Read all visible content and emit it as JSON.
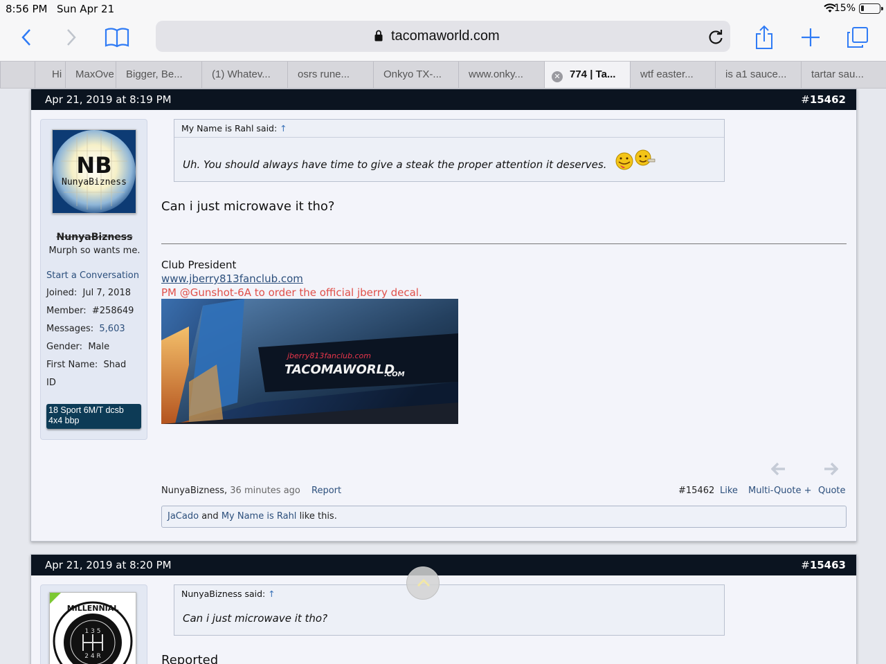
{
  "status_bar": {
    "time": "8:56 PM",
    "date": "Sun Apr 21",
    "battery": "15%"
  },
  "browser": {
    "url": "tacomaworld.com",
    "tabs": [
      {
        "label": "Hi"
      },
      {
        "label": "MaxOve"
      },
      {
        "label": "Bigger, Be..."
      },
      {
        "label": "(1) Whatev..."
      },
      {
        "label": "osrs rune..."
      },
      {
        "label": "Onkyo TX-..."
      },
      {
        "label": "www.onky..."
      },
      {
        "label": "774 | Ta...",
        "active": true
      },
      {
        "label": "wtf easter..."
      },
      {
        "label": "is a1 sauce..."
      },
      {
        "label": "tartar sau..."
      }
    ]
  },
  "post1": {
    "date": "Apr 21, 2019 at 8:19 PM",
    "number_prefix": "#",
    "number": "15462",
    "user": {
      "avatar_text_big": "NB",
      "avatar_text_small": "NunyaBizness",
      "name": "NunyaBizness",
      "title": "Murph so wants me.",
      "start_conversation": "Start a Conversation",
      "stats": [
        {
          "label": "Joined:",
          "value": "Jul 7, 2018"
        },
        {
          "label": "Member:",
          "value": "#258649"
        },
        {
          "label": "Messages:",
          "value": "5,603"
        },
        {
          "label": "Gender:",
          "value": "Male"
        },
        {
          "label": "First Name:",
          "value": "Shad"
        },
        {
          "label": "ID",
          "value": ""
        }
      ],
      "badge": "18 Sport 6M/T dcsb 4x4 bbp"
    },
    "quote": {
      "author": "My Name is Rahl said:",
      "arrow": "↑",
      "text": "Uh. You should always have time to give a steak the proper attention it deserves."
    },
    "message": "Can i just microwave it tho?",
    "signature": {
      "line1": "Club President",
      "link": "www.jberry813fanclub.com",
      "line3": "PM @Gunshot-6A to order the official jberry decal.",
      "decal_small": "jberry813fanclub.com",
      "decal_big": "TACOMAWORLD",
      "decal_com": ".COM"
    },
    "footer": {
      "author": "NunyaBizness,",
      "time": "36 minutes ago",
      "report": "Report",
      "num": "#15462",
      "like": "Like",
      "multiquote": "Multi-Quote +",
      "quote": "Quote"
    },
    "likes": {
      "user1": "JaCado",
      "and": "and",
      "user2": "My Name is Rahl",
      "suffix": "like this."
    }
  },
  "post2": {
    "date": "Apr 21, 2019 at 8:20 PM",
    "number_prefix": "#",
    "number": "15463",
    "avatar_top": "MILLENNIAL",
    "avatar_mid": "1 3 5",
    "avatar_low": "2 4 R",
    "quote": {
      "author": "NunyaBizness said:",
      "arrow": "↑",
      "text": "Can i just microwave it tho?"
    },
    "message": "Reported"
  }
}
